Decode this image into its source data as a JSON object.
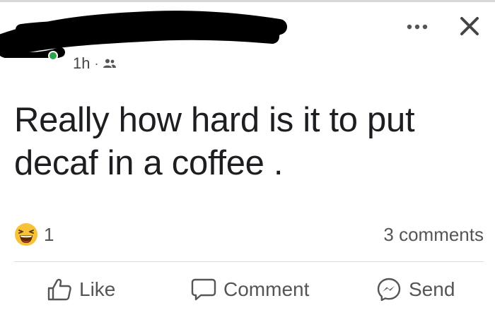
{
  "post": {
    "time": "1h",
    "separator": "·",
    "audience_icon": "friends-icon",
    "text": "Really how hard is it to put\ndecaf in a coffee .",
    "reaction_icon": "haha-emoji-icon",
    "reaction_count": "1",
    "comments_label": "3 comments"
  },
  "header": {
    "more_icon": "more-options-icon",
    "close_icon": "close-icon"
  },
  "actions": {
    "like_label": "Like",
    "comment_label": "Comment",
    "send_label": "Send"
  },
  "colors": {
    "online": "#31a24c",
    "text": "#1c1e21",
    "secondary": "#555555",
    "haha_yellow": "#f7c23a"
  }
}
